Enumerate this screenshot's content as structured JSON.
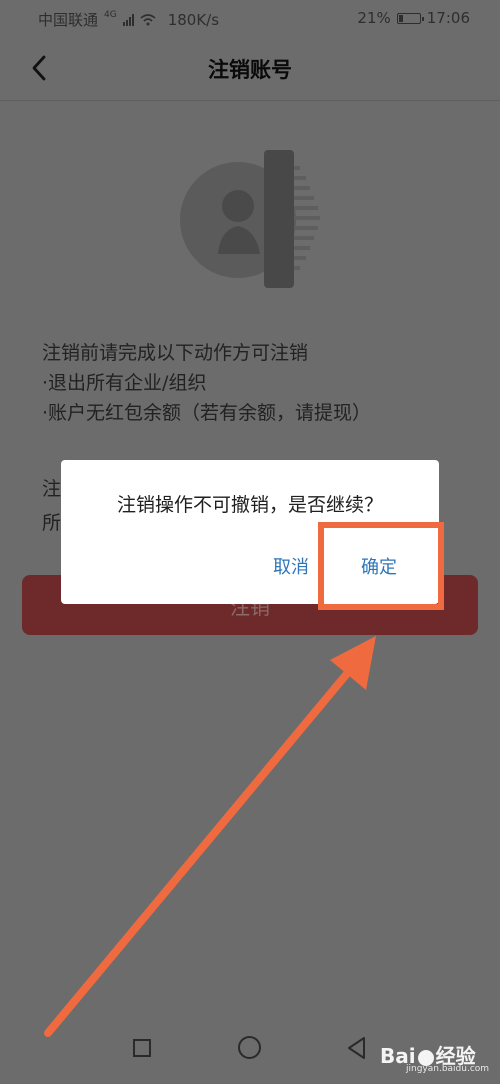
{
  "status_bar": {
    "carrier": "中国联通",
    "network": "4G",
    "speed": "180K/s",
    "battery": "21%",
    "battery_level": 0.21,
    "time": "17:06"
  },
  "header": {
    "title": "注销账号",
    "back_icon": "chevron-left-icon"
  },
  "illustration_icon": "user-shredder-icon",
  "instructions": {
    "heading": "注销前请完成以下动作方可注销",
    "items": [
      "·退出所有企业/组织",
      "·账户无红包余额（若有余额，请提现）"
    ]
  },
  "partial_text": {
    "line1": "注",
    "line2": "所"
  },
  "primary_button": {
    "label": "注销"
  },
  "dialog": {
    "message": "注销操作不可撤销，是否继续？",
    "cancel_label": "取消",
    "confirm_label": "确定"
  },
  "annotation": {
    "color": "#f06a40"
  },
  "nav_bar": {
    "recent_icon": "square-icon",
    "home_icon": "circle-icon",
    "back_icon": "triangle-back-icon"
  },
  "watermark": {
    "brand_left": "Bai",
    "brand_right": "经验",
    "url": "jingyan.baidu.com"
  }
}
